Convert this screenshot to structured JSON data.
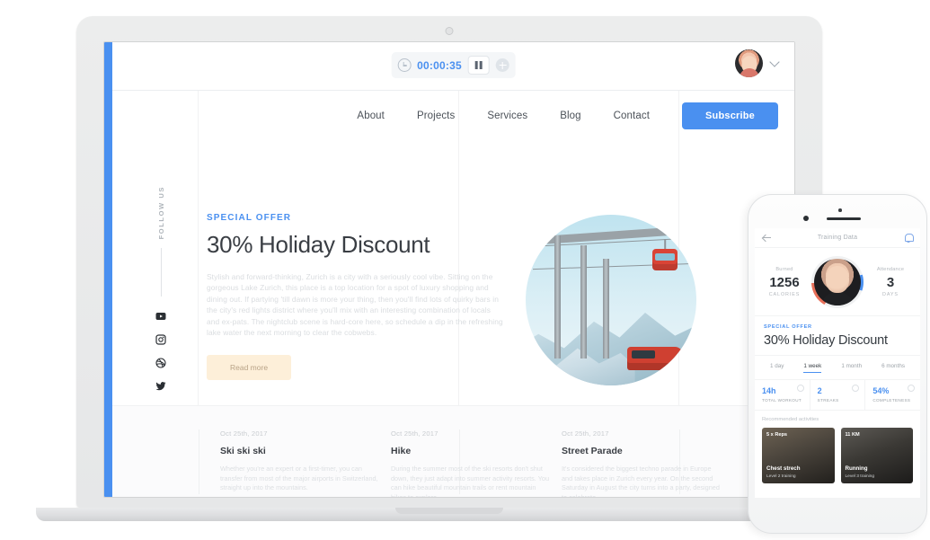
{
  "colors": {
    "accent": "#4a90f0",
    "cta": "#fdefd9",
    "text": "#3a3e44",
    "muted": "#dadde0"
  },
  "laptop": {
    "topbar": {
      "timer": {
        "value": "00:00:35",
        "clock_icon": "clock-icon",
        "pause_icon": "pause-icon",
        "add_icon": "plus-circle-icon"
      },
      "user": {
        "avatar_icon": "user-avatar",
        "chevron_icon": "chevron-down-icon"
      }
    },
    "nav": {
      "items": [
        {
          "label": "About"
        },
        {
          "label": "Projects"
        },
        {
          "label": "Services"
        },
        {
          "label": "Blog"
        },
        {
          "label": "Contact"
        }
      ],
      "cta_label": "Subscribe"
    },
    "rail": {
      "label": "FOLLOW US",
      "socials": [
        {
          "name": "youtube-icon"
        },
        {
          "name": "instagram-icon"
        },
        {
          "name": "dribbble-icon"
        },
        {
          "name": "twitter-icon"
        }
      ]
    },
    "hero": {
      "eyebrow": "SPECIAL OFFER",
      "title": "30% Holiday Discount",
      "body": "Stylish and forward-thinking, Zurich is a city with a seriously cool vibe. Sitting on the gorgeous Lake Zurich, this place is a top location for a spot of luxury shopping and dining out. If partying 'till dawn is more your thing, then you'll find lots of quirky bars in the city's red lights district where you'll mix with an interesting combination of locals and ex-pats. The nightclub scene is hard-core here, so schedule a dip in the refreshing lake water the next morning to clear the cobwebs.",
      "cta_label": "Read more",
      "photo_alt": "ski-cable-car-photo"
    },
    "cards": [
      {
        "date": "Oct 25th, 2017",
        "title": "Ski ski ski",
        "body": "Whether you're an expert or a first-timer, you can transfer from most of the major airports in Switzerland, straight up into the mountains."
      },
      {
        "date": "Oct 25th, 2017",
        "title": "Hike",
        "body": "During the summer most of the ski resorts don't shut down, they just adapt into summer activity resorts. You can hike beautiful mountain trails or rent mountain bikes to explore."
      },
      {
        "date": "Oct 25th, 2017",
        "title": "Street Parade",
        "body": "It's considered the biggest techno parade in Europe and takes place in Zurich every year. On the second Saturday in August the city turns into a party, designed to celebrate."
      }
    ]
  },
  "phone": {
    "nav": {
      "title": "Training Data",
      "back_icon": "back-arrow-icon",
      "bell_icon": "bell-icon"
    },
    "summary": {
      "left": {
        "label": "Burned",
        "value": "1256",
        "unit": "CALORIES"
      },
      "right": {
        "label": "Attendance",
        "value": "3",
        "unit": "DAYS"
      },
      "avatar_icon": "user-avatar"
    },
    "offer": {
      "eyebrow": "SPECIAL OFFER",
      "title": "30% Holiday Discount"
    },
    "tabs": [
      {
        "label": "1 day",
        "active": false
      },
      {
        "label": "1 week",
        "active": true
      },
      {
        "label": "1 month",
        "active": false
      },
      {
        "label": "6 months",
        "active": false
      }
    ],
    "metrics": [
      {
        "value": "14h",
        "label": "TOTAL WORKOUT",
        "icon": "clock-icon"
      },
      {
        "value": "2",
        "label": "STREAKS",
        "icon": "star-icon"
      },
      {
        "value": "54%",
        "label": "COMPLETENESS",
        "icon": "check-circle-icon"
      }
    ],
    "recommended_label": "Recommended activities",
    "activities": [
      {
        "badge": "5 x Reps",
        "title": "Chest strech",
        "subtitle": "Level 2 training"
      },
      {
        "badge": "11 KM",
        "title": "Running",
        "subtitle": "Level 3 training"
      }
    ]
  }
}
